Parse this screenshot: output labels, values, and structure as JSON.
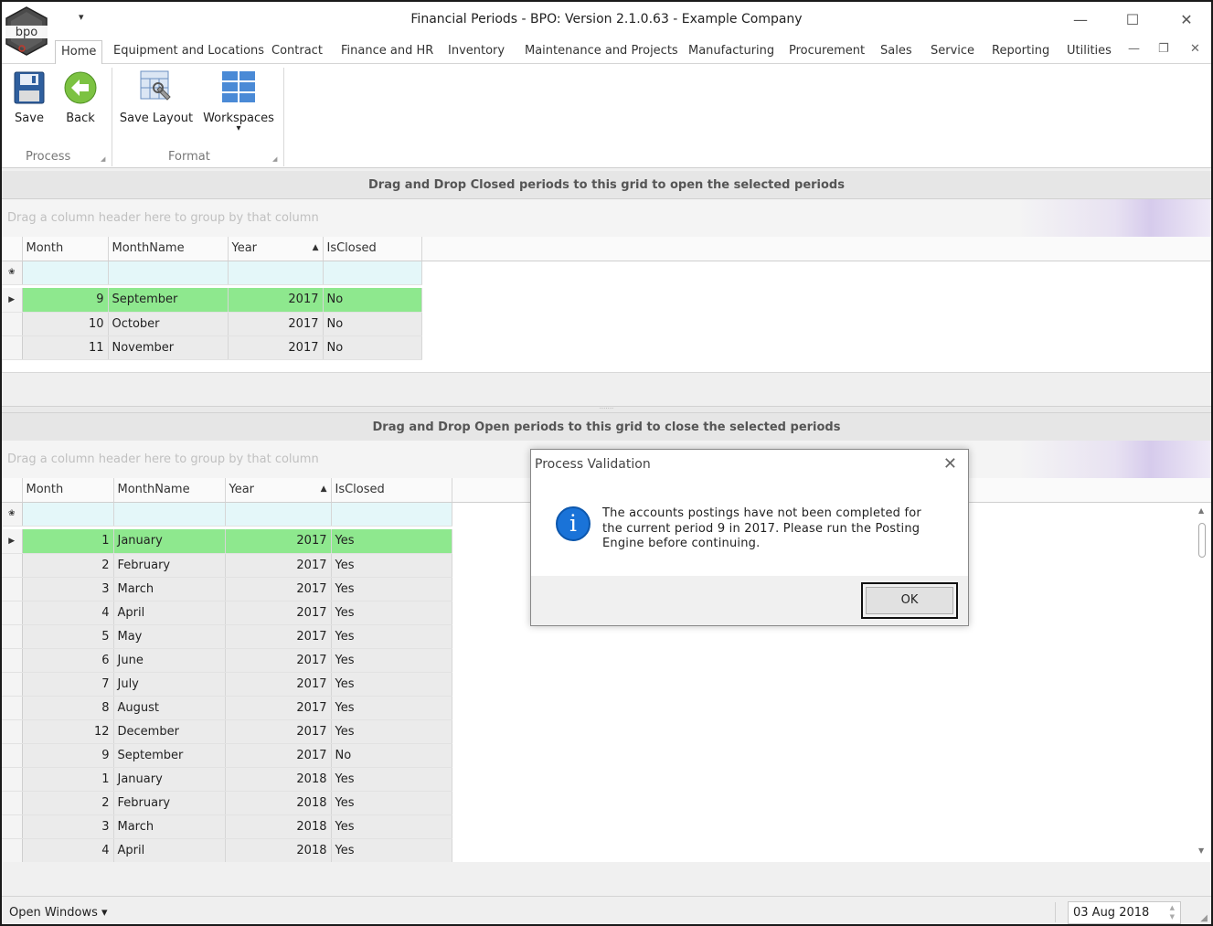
{
  "window": {
    "title": "Financial Periods - BPO: Version 2.1.0.63 - Example Company",
    "logo_text": "bpo",
    "qat_symbol": "▾",
    "minimize": "—",
    "maximize": "☐",
    "close": "✕",
    "mdi_minimize": "—",
    "mdi_restore": "❐",
    "mdi_close": "✕"
  },
  "tabs": [
    {
      "label": "Home",
      "active": true
    },
    {
      "label": "Equipment and Locations"
    },
    {
      "label": "Contract"
    },
    {
      "label": "Finance and HR"
    },
    {
      "label": "Inventory"
    },
    {
      "label": "Maintenance and Projects"
    },
    {
      "label": "Manufacturing"
    },
    {
      "label": "Procurement"
    },
    {
      "label": "Sales"
    },
    {
      "label": "Service"
    },
    {
      "label": "Reporting"
    },
    {
      "label": "Utilities"
    }
  ],
  "ribbon": {
    "groups": [
      {
        "label": "Process",
        "buttons": [
          {
            "label": "Save",
            "icon": "save-icon"
          },
          {
            "label": "Back",
            "icon": "back-arrow-icon"
          }
        ]
      },
      {
        "label": "Format",
        "buttons": [
          {
            "label": "Save Layout",
            "icon": "save-layout-icon"
          },
          {
            "label": "Workspaces",
            "icon": "workspaces-icon",
            "dropdown": "▾"
          }
        ]
      }
    ],
    "launcher": "◢"
  },
  "closed_panel": {
    "header": "Drag and Drop Closed periods to this grid to open the selected periods",
    "groupby_hint": "Drag a column header here to group by that column",
    "columns": [
      "Month",
      "MonthName",
      "Year",
      "IsClosed"
    ],
    "sort_arrow": "▲",
    "rows": [
      {
        "month": "9",
        "name": "September",
        "year": "2017",
        "closed": "No",
        "selected": true
      },
      {
        "month": "10",
        "name": "October",
        "year": "2017",
        "closed": "No"
      },
      {
        "month": "11",
        "name": "November",
        "year": "2017",
        "closed": "No"
      }
    ]
  },
  "open_panel": {
    "header": "Drag and Drop Open periods to this grid to close the selected periods",
    "groupby_hint": "Drag a column header here to group by that column",
    "columns": [
      "Month",
      "MonthName",
      "Year",
      "IsClosed"
    ],
    "sort_arrow": "▲",
    "rows": [
      {
        "month": "1",
        "name": "January",
        "year": "2017",
        "closed": "Yes",
        "selected": true
      },
      {
        "month": "2",
        "name": "February",
        "year": "2017",
        "closed": "Yes"
      },
      {
        "month": "3",
        "name": "March",
        "year": "2017",
        "closed": "Yes"
      },
      {
        "month": "4",
        "name": "April",
        "year": "2017",
        "closed": "Yes"
      },
      {
        "month": "5",
        "name": "May",
        "year": "2017",
        "closed": "Yes"
      },
      {
        "month": "6",
        "name": "June",
        "year": "2017",
        "closed": "Yes"
      },
      {
        "month": "7",
        "name": "July",
        "year": "2017",
        "closed": "Yes"
      },
      {
        "month": "8",
        "name": "August",
        "year": "2017",
        "closed": "Yes"
      },
      {
        "month": "12",
        "name": "December",
        "year": "2017",
        "closed": "Yes"
      },
      {
        "month": "9",
        "name": "September",
        "year": "2017",
        "closed": "No"
      },
      {
        "month": "1",
        "name": "January",
        "year": "2018",
        "closed": "Yes"
      },
      {
        "month": "2",
        "name": "February",
        "year": "2018",
        "closed": "Yes"
      },
      {
        "month": "3",
        "name": "March",
        "year": "2018",
        "closed": "Yes"
      },
      {
        "month": "4",
        "name": "April",
        "year": "2018",
        "closed": "Yes"
      }
    ]
  },
  "indicators": {
    "current_row": "▶",
    "filter_row": "❀"
  },
  "status": {
    "open_windows": "Open Windows ▾",
    "date": "03 Aug 2018",
    "spin_up": "▲",
    "spin_down": "▼",
    "grip": "◢"
  },
  "dialog": {
    "title": "Process Validation",
    "close": "✕",
    "icon": "info-icon",
    "icon_glyph": "i",
    "message": "The accounts postings have not been completed for the current period 9 in 2017.  Please run the Posting Engine before continuing.",
    "ok_label": "OK"
  },
  "colors": {
    "selected_row": "#8ee88e",
    "filter_row": "#e4f7f9",
    "info_icon": "#1a73d8"
  }
}
